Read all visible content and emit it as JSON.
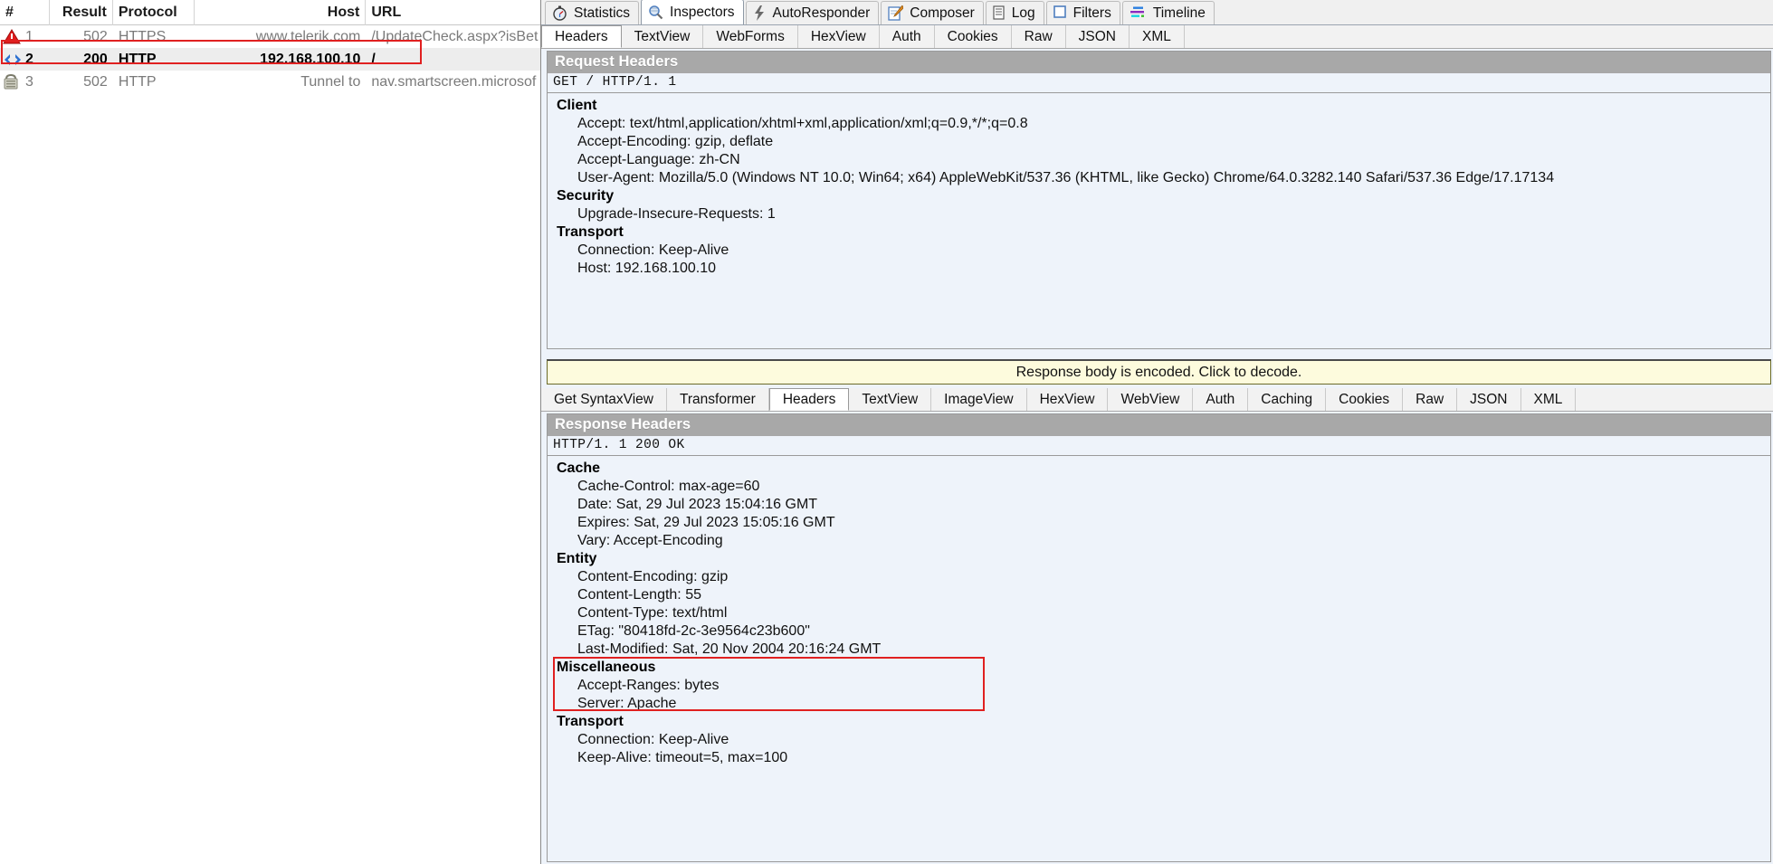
{
  "sessions": {
    "columns": [
      "#",
      "Result",
      "Protocol",
      "Host",
      "URL"
    ],
    "rows": [
      {
        "icon": "warning-triangle-icon",
        "num": "1",
        "result": "502",
        "protocol": "HTTPS",
        "host": "www.telerik.com",
        "url": "/UpdateCheck.aspx?isBet",
        "selected": false
      },
      {
        "icon": "html-code-icon",
        "num": "2",
        "result": "200",
        "protocol": "HTTP",
        "host": "192.168.100.10",
        "url": "/",
        "selected": true
      },
      {
        "icon": "tunnel-lock-icon",
        "num": "3",
        "result": "502",
        "protocol": "HTTP",
        "host": "Tunnel to",
        "url": "nav.smartscreen.microsof",
        "selected": false
      }
    ],
    "selection_highlight_color": "#e02020"
  },
  "main_tabs": [
    {
      "label": "Statistics",
      "icon": "stopwatch-icon",
      "active": false
    },
    {
      "label": "Inspectors",
      "icon": "magnifier-icon",
      "active": true
    },
    {
      "label": "AutoResponder",
      "icon": "lightning-bolt-icon",
      "active": false
    },
    {
      "label": "Composer",
      "icon": "pencil-pad-icon",
      "active": false
    },
    {
      "label": "Log",
      "icon": "list-lines-icon",
      "active": false
    },
    {
      "label": "Filters",
      "icon": "empty-square-icon",
      "active": false
    },
    {
      "label": "Timeline",
      "icon": "timeline-bars-icon",
      "active": false
    }
  ],
  "request": {
    "tabs": [
      {
        "label": "Headers",
        "active": true
      },
      {
        "label": "TextView",
        "active": false
      },
      {
        "label": "WebForms",
        "active": false
      },
      {
        "label": "HexView",
        "active": false
      },
      {
        "label": "Auth",
        "active": false
      },
      {
        "label": "Cookies",
        "active": false
      },
      {
        "label": "Raw",
        "active": false
      },
      {
        "label": "JSON",
        "active": false
      },
      {
        "label": "XML",
        "active": false
      }
    ],
    "panel_title": "Request Headers",
    "status_line": "GET / HTTP/1. 1",
    "groups": [
      {
        "name": "Client",
        "items": [
          "Accept: text/html,application/xhtml+xml,application/xml;q=0.9,*/*;q=0.8",
          "Accept-Encoding: gzip, deflate",
          "Accept-Language: zh-CN",
          "User-Agent: Mozilla/5.0 (Windows NT 10.0; Win64; x64) AppleWebKit/537.36 (KHTML, like Gecko) Chrome/64.0.3282.140 Safari/537.36 Edge/17.17134"
        ]
      },
      {
        "name": "Security",
        "items": [
          "Upgrade-Insecure-Requests: 1"
        ]
      },
      {
        "name": "Transport",
        "items": [
          "Connection: Keep-Alive",
          "Host: 192.168.100.10"
        ]
      }
    ]
  },
  "notice": {
    "text": "Response body is encoded. Click to decode.",
    "background": "#fdfbdd"
  },
  "response": {
    "tabs": [
      {
        "label": "Get SyntaxView",
        "active": false
      },
      {
        "label": "Transformer",
        "active": false
      },
      {
        "label": "Headers",
        "active": true
      },
      {
        "label": "TextView",
        "active": false
      },
      {
        "label": "ImageView",
        "active": false
      },
      {
        "label": "HexView",
        "active": false
      },
      {
        "label": "WebView",
        "active": false
      },
      {
        "label": "Auth",
        "active": false
      },
      {
        "label": "Caching",
        "active": false
      },
      {
        "label": "Cookies",
        "active": false
      },
      {
        "label": "Raw",
        "active": false
      },
      {
        "label": "JSON",
        "active": false
      },
      {
        "label": "XML",
        "active": false
      }
    ],
    "panel_title": "Response Headers",
    "status_line": "HTTP/1. 1 200 OK",
    "groups": [
      {
        "name": "Cache",
        "items": [
          "Cache-Control: max-age=60",
          "Date: Sat, 29 Jul 2023 15:04:16 GMT",
          "Expires: Sat, 29 Jul 2023 15:05:16 GMT",
          "Vary: Accept-Encoding"
        ]
      },
      {
        "name": "Entity",
        "items": [
          "Content-Encoding: gzip",
          "Content-Length: 55",
          "Content-Type: text/html",
          "ETag: \"80418fd-2c-3e9564c23b600\"",
          "Last-Modified: Sat, 20 Nov 2004 20:16:24 GMT"
        ]
      },
      {
        "name": "Miscellaneous",
        "highlighted": true,
        "items": [
          "Accept-Ranges: bytes",
          "Server: Apache"
        ]
      },
      {
        "name": "Transport",
        "items": [
          "Connection: Keep-Alive",
          "Keep-Alive: timeout=5, max=100"
        ]
      }
    ]
  }
}
